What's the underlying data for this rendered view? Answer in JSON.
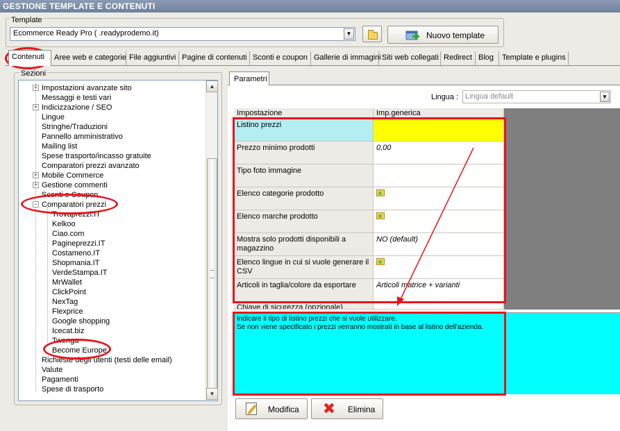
{
  "window": {
    "title": "GESTIONE TEMPLATE E CONTENUTI"
  },
  "template": {
    "legend": "Template",
    "selected_value": "Ecommerce Ready Pro (                              .readyprodemo.it)",
    "new_template_label": "Nuovo template"
  },
  "tabs": [
    {
      "label": "Contenuti"
    },
    {
      "label": "Aree web e categorie"
    },
    {
      "label": "File aggiuntivi"
    },
    {
      "label": "Pagine di contenuti"
    },
    {
      "label": "Sconti e coupon"
    },
    {
      "label": "Gallerie di immagini"
    },
    {
      "label": "Siti web collegati"
    },
    {
      "label": "Redirect"
    },
    {
      "label": "Blog"
    },
    {
      "label": "Template e plugins"
    }
  ],
  "sections": {
    "legend": "Sezioni",
    "items": [
      {
        "label": "Impostazioni avanzate sito"
      },
      {
        "label": "Messaggi e testi vari"
      },
      {
        "label": "Indicizzazione / SEO"
      },
      {
        "label": "Lingue"
      },
      {
        "label": "Stringhe/Traduzioni"
      },
      {
        "label": "Pannello amministrativo"
      },
      {
        "label": "Mailing list"
      },
      {
        "label": "Spese trasporto/incasso gratuite"
      },
      {
        "label": "Comparatori prezzi avanzato"
      },
      {
        "label": "Mobile Commerce"
      },
      {
        "label": "Gestione commenti"
      },
      {
        "label": "Sconti e Coupon"
      },
      {
        "label": "Comparatori prezzi"
      },
      {
        "label": "Trovaprezzi.IT"
      },
      {
        "label": "Kelkoo"
      },
      {
        "label": "Ciao.com"
      },
      {
        "label": "Pagineprezzi.IT"
      },
      {
        "label": "Costameno.IT"
      },
      {
        "label": "Shopmania.IT"
      },
      {
        "label": "VerdeStampa.IT"
      },
      {
        "label": "MrWallet"
      },
      {
        "label": "ClickPoint"
      },
      {
        "label": "NexTag"
      },
      {
        "label": "Flexprice"
      },
      {
        "label": "Google shopping"
      },
      {
        "label": "Icecat.biz"
      },
      {
        "label": "Twenga"
      },
      {
        "label": "Become Europe"
      },
      {
        "label": "Richieste degli utenti (testi delle email)"
      },
      {
        "label": "Valute"
      },
      {
        "label": "Pagamenti"
      },
      {
        "label": "Spese di trasporto"
      }
    ]
  },
  "params": {
    "tab_label": "Parametri",
    "lingua_label": "Lingua :",
    "lingua_value": "Lingua default",
    "headers": {
      "setting": "Impostazione",
      "value": "Imp.generica"
    },
    "rows": [
      {
        "setting": "Listino prezzi",
        "value": ""
      },
      {
        "setting": "Prezzo minimo prodotti",
        "value": "0,00"
      },
      {
        "setting": "Tipo foto immagine",
        "value": ""
      },
      {
        "setting": "Elenco categorie prodotto",
        "value": ""
      },
      {
        "setting": "Elenco marche prodotto",
        "value": ""
      },
      {
        "setting": "Mostra solo prodotti disponibili a magazzino",
        "value": "NO (default)"
      },
      {
        "setting": "Elenco lingue in cui si vuole generare il CSV",
        "value": ""
      },
      {
        "setting": "Articoli in taglia/colore da esportare",
        "value": "Articoli matrice + varianti"
      },
      {
        "setting": "Chiave di sicurezza (opzionale)",
        "value": ""
      }
    ],
    "description_line1": "Indicare il tipo di listino prezzi che si vuole utilizzare.",
    "description_line2": "Se non viene specificato i prezzi verranno mostrati in base al listino dell'azienda."
  },
  "buttons": {
    "modifica": "Modifica",
    "elimina": "Elimina"
  },
  "colors": {
    "highlight_row": "#b3eef2",
    "highlight_value": "#ffff00",
    "description_bg": "#00ffff",
    "annotation": "#e8141a"
  }
}
